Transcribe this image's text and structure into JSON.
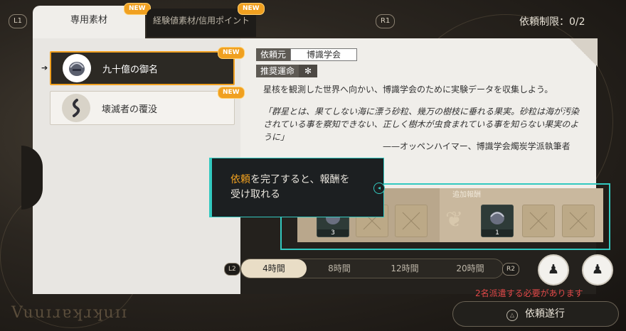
{
  "top": {
    "l1": "L1",
    "r1": "R1",
    "tab_active": "専用素材",
    "tab_inactive": "経験値素材/信用ポイント",
    "new": "NEW",
    "limit": "依頼制限：0/2"
  },
  "items": [
    {
      "label": "九十億の御名",
      "badge": "NEW",
      "selected": true
    },
    {
      "label": "壊滅者の覆没",
      "badge": "NEW",
      "selected": false
    }
  ],
  "detail": {
    "client_key": "依頼元",
    "client_val": "博識学会",
    "path_key": "推奨運命",
    "description": "星核を観測した世界へ向かい、博識学会のために実験データを収集しよう。",
    "quote": "「群星とは、果てしない海に漂う砂粒、幾万の樹枝に垂れる果実。砂粒は海が汚染されている事を察知できない、正しく樹木が虫食まれている事を知らない果実のように」",
    "author": "——オッペンハイマー、博識学会燭炭学派執筆者"
  },
  "rewards": {
    "bonus_label": "追加報酬",
    "slot1_count": "3",
    "slot2_count": "1"
  },
  "tooltip": {
    "highlight": "依頼",
    "rest": "を完了すると、報酬を受け取れる"
  },
  "time": {
    "l2": "L2",
    "r2": "R2",
    "options": [
      "4時間",
      "8時間",
      "12時間",
      "20時間"
    ],
    "selected": 0
  },
  "dispatch": {
    "need_text": "2名派遣する必要があります",
    "button": "依頼遂行",
    "button_icon": "△"
  },
  "brand": "Vuuɪɹɐʞɹʞuɪɪ",
  "colors": {
    "accent_orange": "#f0a020",
    "accent_teal": "#33c9c0",
    "warning_red": "#e04848"
  }
}
